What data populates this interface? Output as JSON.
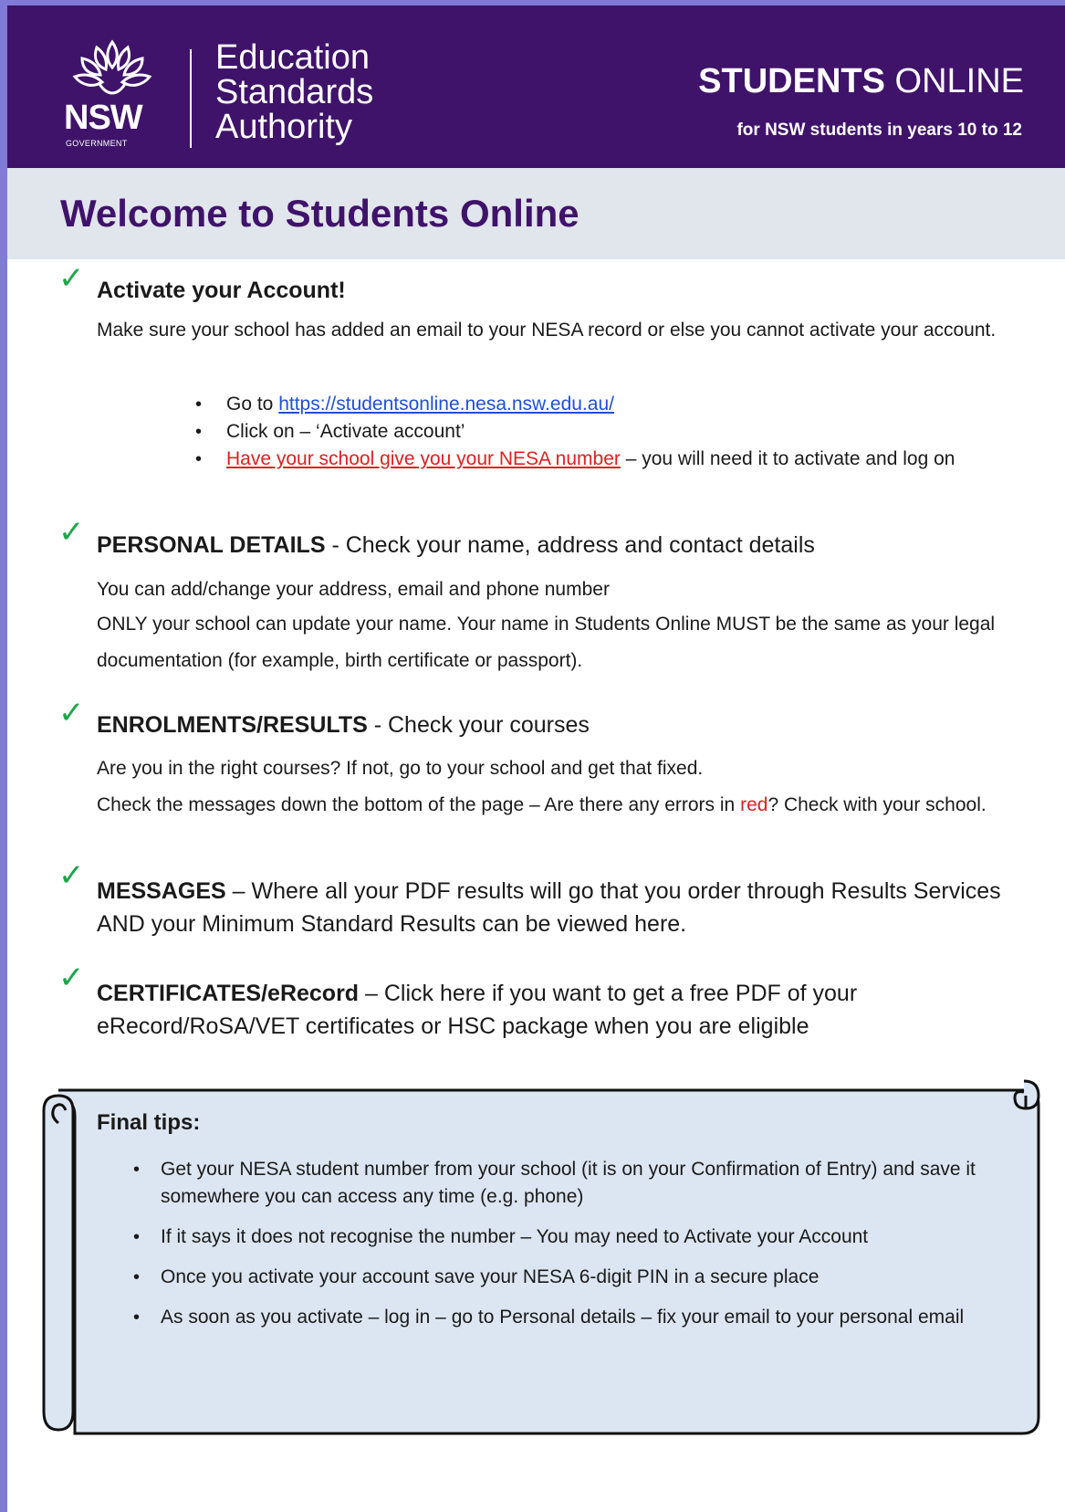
{
  "header": {
    "logo": {
      "text": "NSW",
      "subtext": "GOVERNMENT",
      "icon": "waratah-icon"
    },
    "agency_lines": [
      "Education",
      "Standards",
      "Authority"
    ],
    "app_title_bold": "STUDENTS",
    "app_title_rest": " ONLINE",
    "app_subtitle": "for NSW students in years 10 to 12"
  },
  "welcome": {
    "title": "Welcome to Students Online"
  },
  "sections": {
    "activate": {
      "heading": "Activate your Account!",
      "body": "Make sure your school has added an email to your NESA record or else you cannot activate your account.",
      "bullets": {
        "b1_prefix": "Go to ",
        "b1_link": "https://studentsonline.nesa.nsw.edu.au/",
        "b2": "Click on – ‘Activate account’",
        "b3_red": "Have your school give you your NESA number",
        "b3_rest": " – you will need it to activate and log on"
      }
    },
    "personal": {
      "heading_bold": "PERSONAL DETAILS",
      "heading_rest": " - Check your name, address and contact details",
      "line1": "You can add/change your address, email and phone number",
      "line2": "ONLY your school can update your name. Your name in Students Online MUST be the same as your legal documentation (for example, birth certificate or passport)."
    },
    "enrolments": {
      "heading_bold": "ENROLMENTS/RESULTS",
      "heading_rest": " - Check your courses",
      "line1": "Are you in the right courses? If not, go to your school and get that fixed.",
      "line2_pre": "Check the messages down the bottom of the page – Are there any errors in ",
      "line2_red": "red",
      "line2_post": "? Check with your school."
    },
    "messages": {
      "heading_bold": "MESSAGES",
      "text": " – Where all your PDF results will go that you order through Results Services AND your Minimum Standard Results can be viewed here."
    },
    "certificates": {
      "heading_bold": "CERTIFICATES/eRecord",
      "text": " – Click here if you want to get a free PDF of your eRecord/RoSA/VET certificates or HSC package when you are eligible"
    }
  },
  "tips": {
    "title": "Final tips:",
    "items": [
      "Get your NESA student number from your school (it is on your Confirmation of Entry) and save it somewhere you can access any time (e.g. phone)",
      "If it says it does not recognise the number – You may need to Activate your Account",
      "Once you activate your account save your NESA 6-digit PIN in a secure place",
      "As soon as you activate – log in – go to Personal details – fix your email to your personal email"
    ]
  },
  "colors": {
    "header_purple": "#3f136a",
    "check_green": "#1ea64a",
    "link_blue": "#1f4fd8",
    "alert_red": "#e02020",
    "scroll_fill": "#dce6f2"
  }
}
